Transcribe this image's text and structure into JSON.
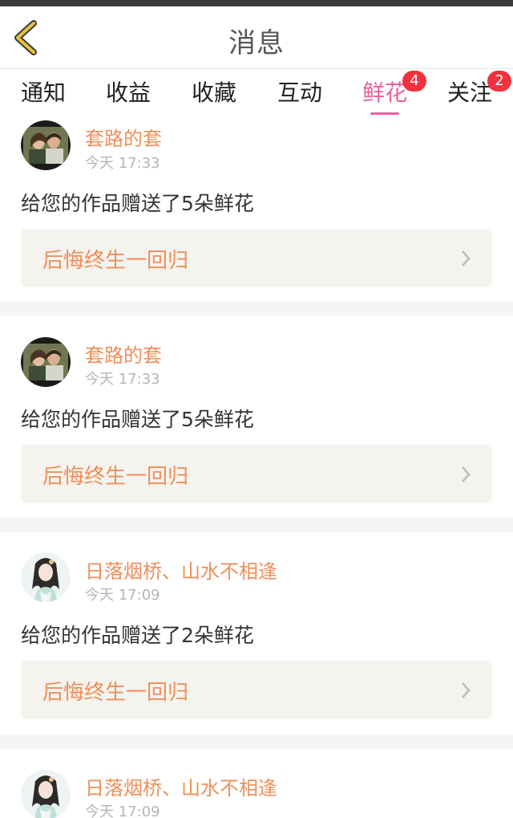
{
  "header": {
    "title": "消息"
  },
  "tabs": [
    {
      "label": "通知",
      "active": false,
      "badge": ""
    },
    {
      "label": "收益",
      "active": false,
      "badge": ""
    },
    {
      "label": "收藏",
      "active": false,
      "badge": ""
    },
    {
      "label": "互动",
      "active": false,
      "badge": ""
    },
    {
      "label": "鲜花",
      "active": true,
      "badge": "4"
    },
    {
      "label": "关注",
      "active": false,
      "badge": "2"
    }
  ],
  "messages": [
    {
      "avatar": "couple-photo-avatar",
      "username": "套路的套",
      "time": "今天 17:33",
      "text": "给您的作品赠送了5朵鲜花",
      "work": "后悔终生一回归"
    },
    {
      "avatar": "couple-photo-avatar",
      "username": "套路的套",
      "time": "今天 17:33",
      "text": "给您的作品赠送了5朵鲜花",
      "work": "后悔终生一回归"
    },
    {
      "avatar": "anime-girl-avatar",
      "username": "日落烟桥、山水不相逢",
      "time": "今天 17:09",
      "text": "给您的作品赠送了2朵鲜花",
      "work": "后悔终生一回归"
    },
    {
      "avatar": "anime-girl-avatar",
      "username": "日落烟桥、山水不相逢",
      "time": "今天 17:09",
      "text": "",
      "work": ""
    }
  ],
  "colors": {
    "accent": "#e8629a",
    "username": "#ef8f5a",
    "badge": "#f0313f",
    "back_arrow": "#e6c13a"
  }
}
